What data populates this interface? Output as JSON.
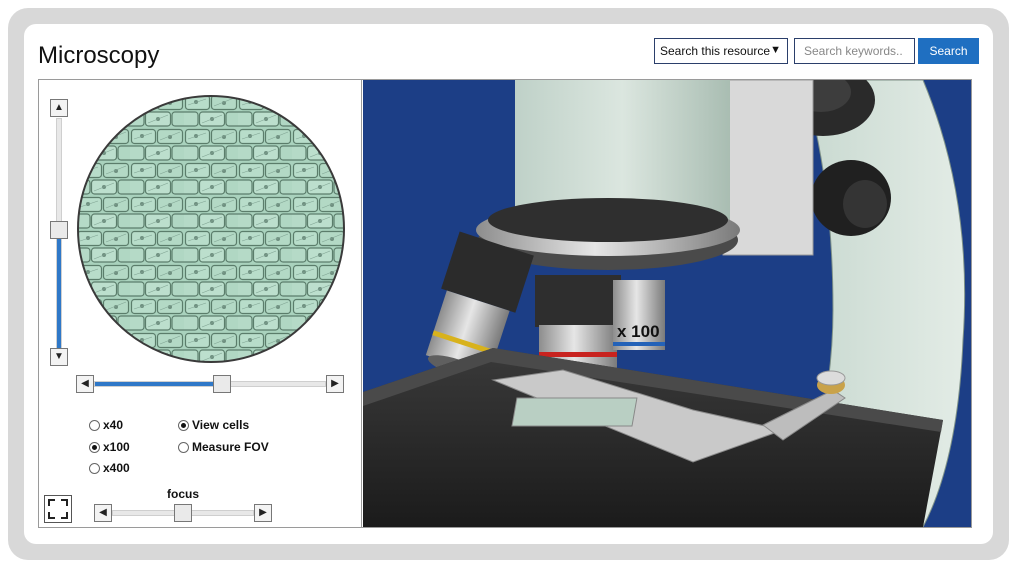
{
  "page": {
    "title": "Microscopy"
  },
  "search": {
    "scope_label": "Search this resource",
    "scope_arrow": "▼",
    "keywords_placeholder": "Search keywords..",
    "button_label": "Search"
  },
  "controls": {
    "zoom_up": "▲",
    "zoom_down": "▼",
    "pan_left": "◀",
    "pan_right": "▶",
    "vertical_slider_level": 0.52,
    "horizontal_slider_level": 0.55,
    "focus_slider_level": 0.5,
    "magnifications": [
      {
        "label": "x40",
        "selected": false
      },
      {
        "label": "x100",
        "selected": true
      },
      {
        "label": "x400",
        "selected": false
      }
    ],
    "modes": [
      {
        "label": "View cells",
        "selected": true
      },
      {
        "label": "Measure FOV",
        "selected": false
      }
    ],
    "focus_label": "focus"
  },
  "scene": {
    "objective_label": "x 100",
    "background_color": "#1c3e86"
  }
}
